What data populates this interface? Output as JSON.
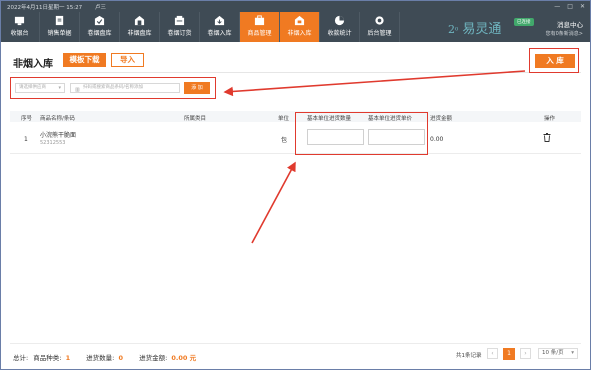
{
  "topbar": {
    "datetime": "2022年4月11日星期一 15:27",
    "user": "卢三",
    "brand": "易灵通",
    "badge": "已连接",
    "message_center": "消息中心",
    "message_sub": "您有0条新消息>",
    "nav": [
      {
        "label": "收银台",
        "icon": "cashier-icon"
      },
      {
        "label": "销售单据",
        "icon": "sales-doc-icon"
      },
      {
        "label": "卷烟盘库",
        "icon": "tobacco-check-icon"
      },
      {
        "label": "非烟盘库",
        "icon": "non-tobacco-check-icon"
      },
      {
        "label": "卷烟订货",
        "icon": "tobacco-order-icon"
      },
      {
        "label": "卷烟入库",
        "icon": "tobacco-stock-icon"
      },
      {
        "label": "商品管理",
        "icon": "product-mgmt-icon"
      },
      {
        "label": "非烟入库",
        "icon": "non-tobacco-stock-icon"
      },
      {
        "label": "收款统计",
        "icon": "stats-icon"
      },
      {
        "label": "后台管理",
        "icon": "settings-icon"
      }
    ]
  },
  "page": {
    "title": "非烟入库",
    "template_btn": "模板下载",
    "import_btn": "导入",
    "stock_btn": "入 库"
  },
  "search": {
    "supplier_placeholder": "请选择供应商",
    "product_placeholder": "扫码或搜索商品条码/名称添加",
    "add_btn": "添 加"
  },
  "table": {
    "headers": {
      "seq": "序号",
      "name": "商品名称/条码",
      "category": "所属类目",
      "unit": "单位",
      "qty": "基本单位进货数量",
      "price": "基本单位进货单价",
      "amount": "进货金额",
      "action": "操作"
    },
    "rows": [
      {
        "seq": "1",
        "name": "小浣熊干脆面",
        "code": "52312553",
        "category": "",
        "unit": "包",
        "qty": "",
        "price": "",
        "amount": "0.00"
      }
    ]
  },
  "footer": {
    "total_label": "总计:",
    "kinds_label": "商品种类:",
    "kinds": "1",
    "qty_label": "进货数量:",
    "qty": "0",
    "amount_label": "进货金额:",
    "amount": "0.00 元",
    "records": "共1条记录",
    "current_page": "1",
    "page_size": "10 条/页"
  },
  "colors": {
    "accent": "#f07a22",
    "topbar": "#3f4b55",
    "annotation": "#e03a2e"
  }
}
